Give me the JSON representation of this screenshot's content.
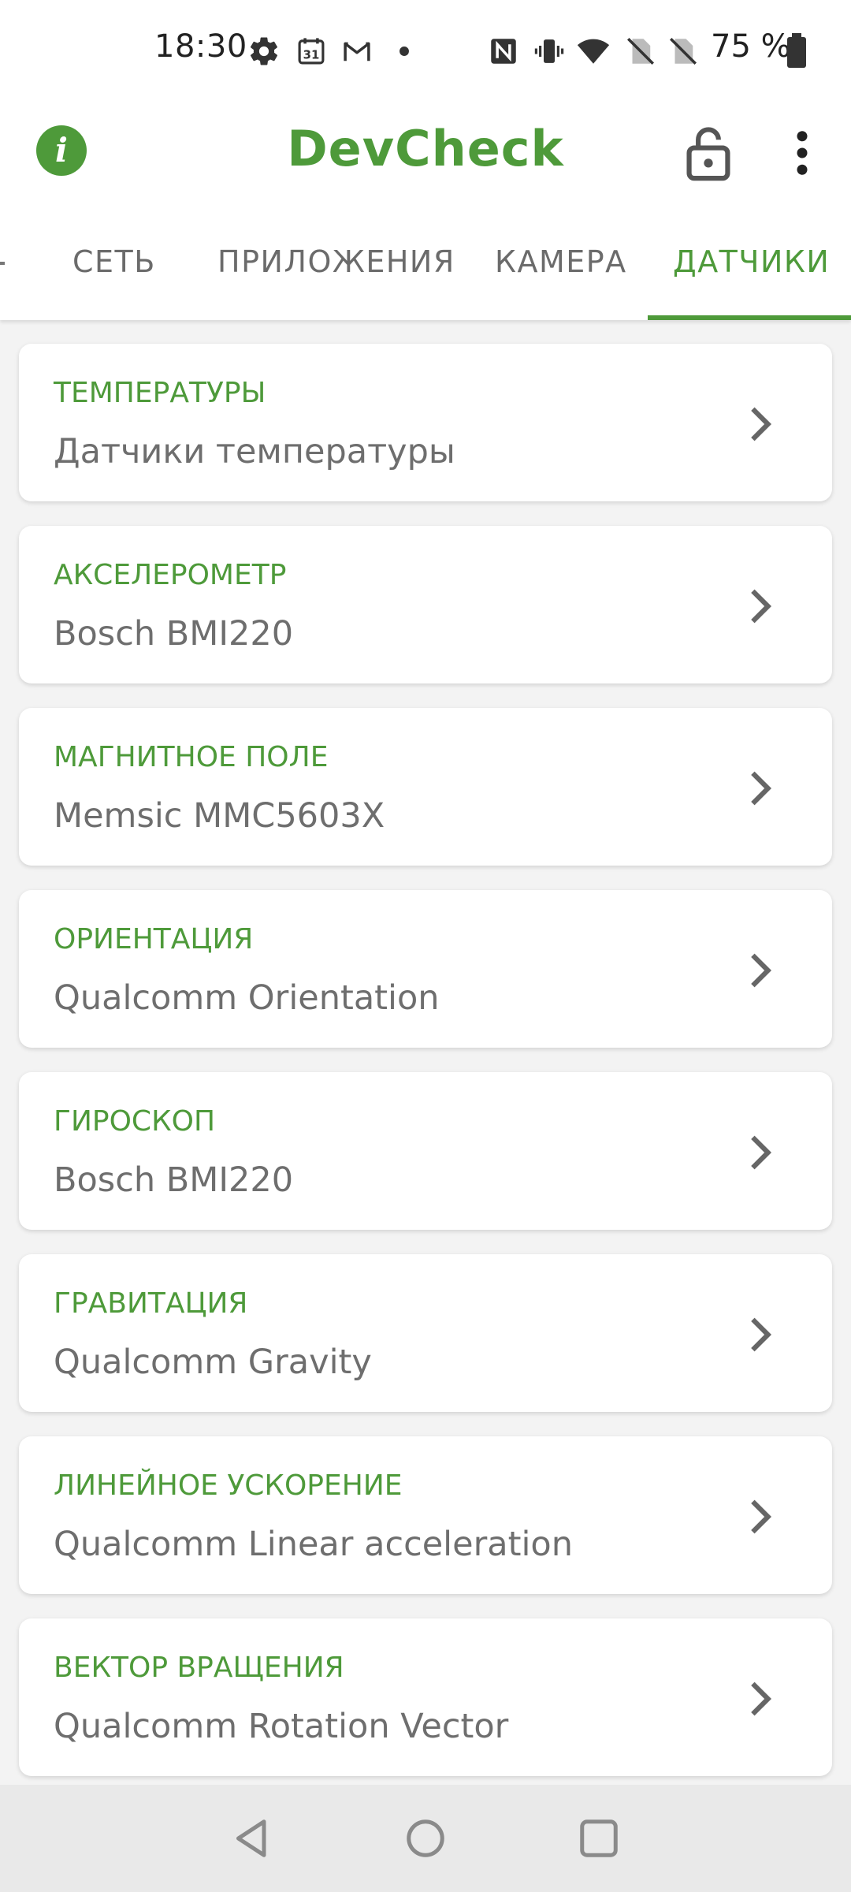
{
  "status_bar": {
    "time": "18:30",
    "battery_text": "75 %",
    "icons": [
      "gear-icon",
      "calendar-icon",
      "gmail-icon",
      "dot-icon",
      "nfc-icon",
      "vibrate-icon",
      "wifi-icon",
      "no-sim-icon",
      "no-sim-icon",
      "battery-icon"
    ],
    "calendar_day": "31"
  },
  "app_bar": {
    "title": "DevCheck",
    "info_glyph": "i",
    "icons": [
      "info-icon",
      "lock-open-icon",
      "more-vert-icon"
    ]
  },
  "tabs": [
    {
      "label": "СЕТЬ",
      "active": false
    },
    {
      "label": "ПРИЛОЖЕНИЯ",
      "active": false
    },
    {
      "label": "КАМЕРА",
      "active": false
    },
    {
      "label": "ДАТЧИКИ",
      "active": true
    }
  ],
  "sensors": [
    {
      "title": "ТЕМПЕРАТУРЫ",
      "value": "Датчики температуры"
    },
    {
      "title": "АКСЕЛЕРОМЕТР",
      "value": "Bosch BMI220"
    },
    {
      "title": "МАГНИТНОЕ ПОЛЕ",
      "value": "Memsic MMC5603X"
    },
    {
      "title": "ОРИЕНТАЦИЯ",
      "value": "Qualcomm Orientation"
    },
    {
      "title": "ГИРОСКОП",
      "value": "Bosch BMI220"
    },
    {
      "title": "ГРАВИТАЦИЯ",
      "value": "Qualcomm Gravity"
    },
    {
      "title": "ЛИНЕЙНОЕ УСКОРЕНИЕ",
      "value": "Qualcomm Linear acceleration"
    },
    {
      "title": "ВЕКТОР ВРАЩЕНИЯ",
      "value": "Qualcomm Rotation Vector"
    }
  ],
  "nav_bar": {
    "icons": [
      "back-icon",
      "home-icon",
      "recents-icon"
    ]
  },
  "colors": {
    "accent": "#4e9a3a",
    "text_secondary": "#6e6e6e",
    "background": "#f3f3f3"
  }
}
